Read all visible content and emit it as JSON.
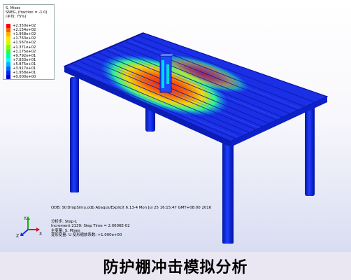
{
  "legend": {
    "field": "S, Mises",
    "section": "SNEG, (fraction = -1.0)",
    "average": "(平均: 75%)",
    "values": [
      "+2.350e+02",
      "+2.154e+02",
      "+1.958e+02",
      "+1.763e+02",
      "+1.567e+02",
      "+1.371e+02",
      "+1.175e+02",
      "+9.792e+01",
      "+7.833e+01",
      "+5.875e+01",
      "+3.917e+01",
      "+1.958e+01",
      "+0.000e+00"
    ],
    "colors": [
      "#ff0000",
      "#ff5a00",
      "#ffae00",
      "#ffe600",
      "#c8ff00",
      "#7dff00",
      "#28ff3c",
      "#00ff9b",
      "#00ffee",
      "#00b4ff",
      "#0064ff",
      "#0022ff",
      "#0000c8"
    ]
  },
  "odb": {
    "line1": "ODB: StrDropSimu.odb    Abaqus/Explicit 6.13-4    Mon Jul 25 16:15:47 GMT+08:00 2016",
    "line2": "分析步: Step-1",
    "line3": "Increment    2139: Step Time =    2.0006E-02",
    "line4": "主变量: S, Mises",
    "line5": "变形变量: U   变形缩放系数: +1.000e+00"
  },
  "triad": {
    "x": "X",
    "y": "Y",
    "z": "Z"
  },
  "caption": "防护棚冲击模拟分析"
}
